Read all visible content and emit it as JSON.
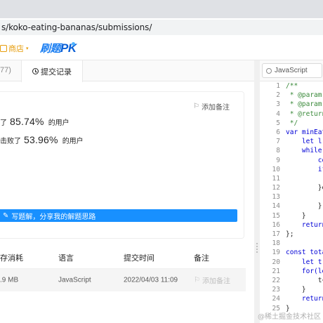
{
  "browser": {
    "url": "s/koko-eating-bananas/submissions/"
  },
  "site_nav": {
    "shop_label": "商店",
    "shop_arrow": "▾",
    "logo_text": "刷题",
    "logo_pk": "PK"
  },
  "tabs": {
    "count_label": "77)",
    "submissions_label": "提交记录"
  },
  "result": {
    "add_note_label": "添加备注",
    "stat1_prefix": "了",
    "stat1_value": "85.74%",
    "stat1_suffix": "的用户",
    "stat2_prefix": "击败了",
    "stat2_value": "53.96%",
    "stat2_suffix": "的用户",
    "share_label": "写题解，分享我的解题思路"
  },
  "table": {
    "headers": [
      "存消耗",
      "语言",
      "提交时间",
      "备注"
    ],
    "row": {
      "memory": ".9 MB",
      "language": "JavaScript",
      "time": "2022/04/03 11:09",
      "note": "添加备注"
    }
  },
  "editor": {
    "language": "JavaScript",
    "line_numbers": [
      "1",
      "2",
      "3",
      "4",
      "5",
      "6",
      "7",
      "8",
      "9",
      "10",
      "11",
      "12",
      "13",
      "14",
      "15",
      "16",
      "17",
      "18",
      "19",
      "20",
      "21",
      "22",
      "23",
      "24",
      "25"
    ],
    "lines": [
      {
        "t": "/**",
        "c": "cm"
      },
      {
        "t": " * @param",
        "c": "cm"
      },
      {
        "t": " * @param",
        "c": "cm"
      },
      {
        "t": " * @return",
        "c": "cm"
      },
      {
        "t": " */",
        "c": "cm"
      },
      {
        "t": "var minEat",
        "c": "kw"
      },
      {
        "t": "    let l",
        "c": "kw"
      },
      {
        "t": "    while(",
        "c": "kw"
      },
      {
        "t": "        co",
        "c": "kw"
      },
      {
        "t": "        if",
        "c": "kw"
      },
      {
        "t": "",
        "c": "pl"
      },
      {
        "t": "        }el",
        "c": "pl"
      },
      {
        "t": "",
        "c": "pl"
      },
      {
        "t": "        }",
        "c": "pl"
      },
      {
        "t": "    }",
        "c": "pl"
      },
      {
        "t": "    return",
        "c": "kw"
      },
      {
        "t": "};",
        "c": "pl"
      },
      {
        "t": "",
        "c": "pl"
      },
      {
        "t": "const tota",
        "c": "kw"
      },
      {
        "t": "    let t",
        "c": "kw"
      },
      {
        "t": "    for(le",
        "c": "kw"
      },
      {
        "t": "        t+",
        "c": "pl"
      },
      {
        "t": "    }",
        "c": "pl"
      },
      {
        "t": "    return",
        "c": "kw"
      },
      {
        "t": "}",
        "c": "pl"
      }
    ]
  },
  "watermark": "@稀土掘金技术社区",
  "colors": {
    "primary": "#1890ff",
    "shop": "#e69c0b",
    "comment": "#3b8a3b",
    "keyword": "#0000d6"
  }
}
